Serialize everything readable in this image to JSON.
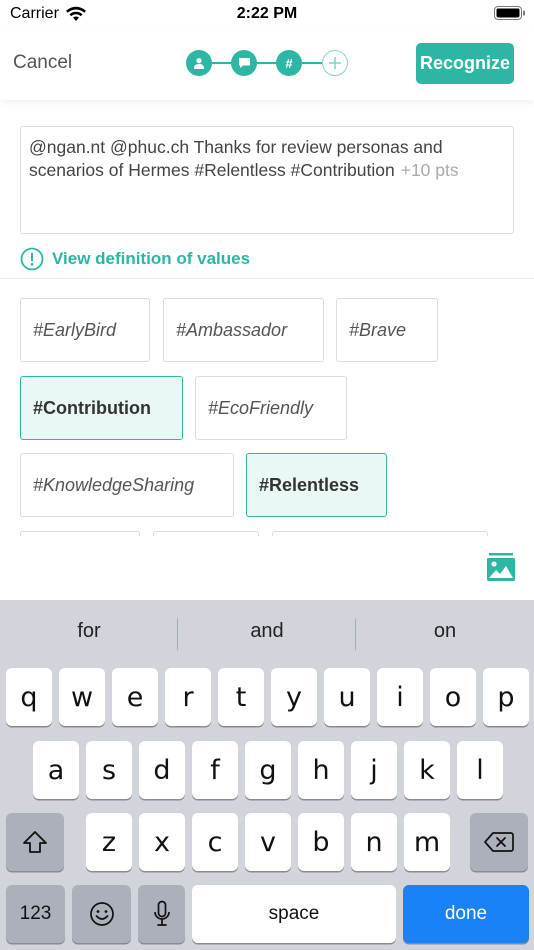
{
  "status_bar": {
    "carrier": "Carrier",
    "time": "2:22 PM"
  },
  "header": {
    "cancel_label": "Cancel",
    "recognize_label": "Recognize",
    "step_hash": "#"
  },
  "message": {
    "text": "@ngan.nt @phuc.ch Thanks for review personas and scenarios of Hermes #Relentless #Contribution",
    "points": "+10 pts"
  },
  "definition_link": "View definition of values",
  "values": [
    {
      "label": "#EarlyBird",
      "selected": false
    },
    {
      "label": "#Ambassador",
      "selected": false
    },
    {
      "label": "#Brave",
      "selected": false
    },
    {
      "label": "#Contribution",
      "selected": true
    },
    {
      "label": "#EcoFriendly",
      "selected": false
    },
    {
      "label": "#KnowledgeSharing",
      "selected": false
    },
    {
      "label": "#Relentless",
      "selected": true
    }
  ],
  "keyboard": {
    "suggestions": [
      "for",
      "and",
      "on"
    ],
    "row1": [
      "q",
      "w",
      "e",
      "r",
      "t",
      "y",
      "u",
      "i",
      "o",
      "p"
    ],
    "row2": [
      "a",
      "s",
      "d",
      "f",
      "g",
      "h",
      "j",
      "k",
      "l"
    ],
    "row3": [
      "z",
      "x",
      "c",
      "v",
      "b",
      "n",
      "m"
    ],
    "numbers_label": "123",
    "space_label": "space",
    "done_label": "done"
  },
  "colors": {
    "accent": "#2bb7a4",
    "selected_bg": "#eaf8f5",
    "done_blue": "#1a82f7"
  }
}
